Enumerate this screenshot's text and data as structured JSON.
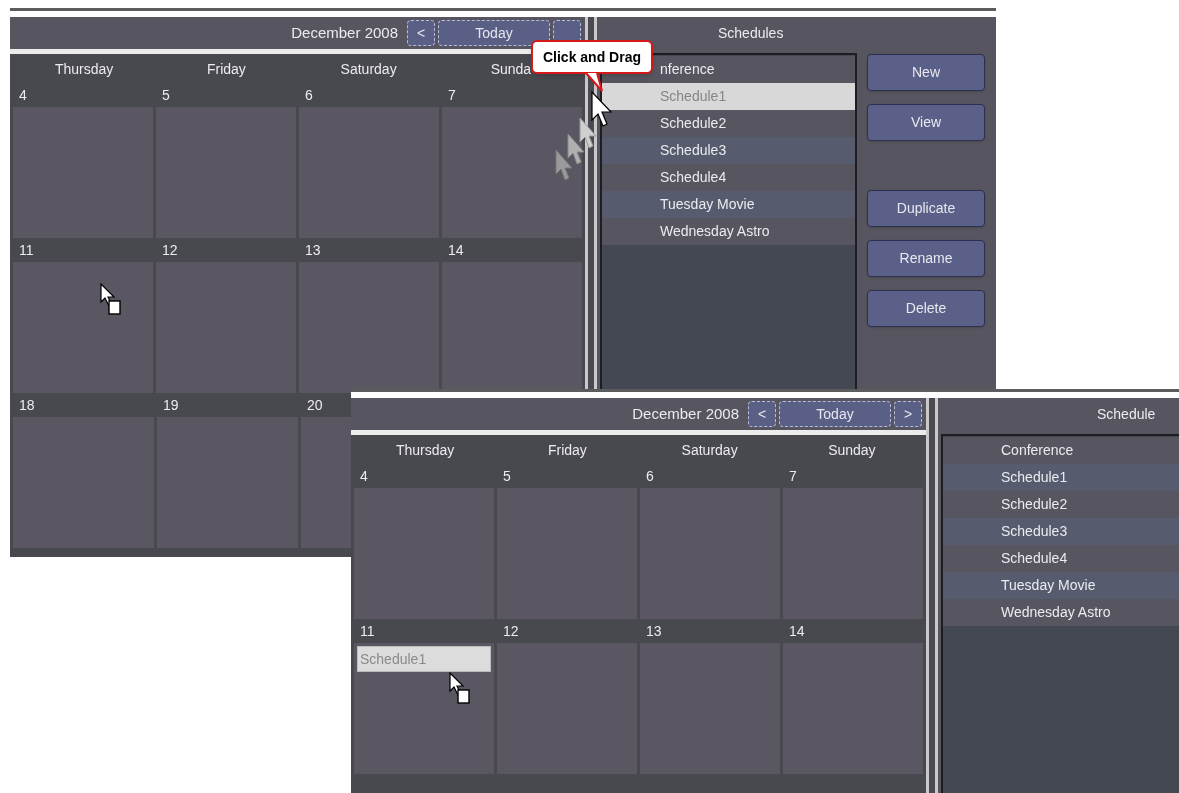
{
  "windows": [
    {
      "header": {
        "month": "December 2008",
        "buttons": [
          {
            "kind": "prev",
            "label": "<"
          },
          {
            "kind": "today",
            "label": "Today"
          },
          {
            "kind": "next"
          }
        ]
      },
      "weekdays": [
        "Thursday",
        "Friday",
        "Saturday",
        "Sunda"
      ],
      "weeks": [
        {
          "days": [
            {
              "date": "4"
            },
            {
              "date": "5"
            },
            {
              "date": "6"
            },
            {
              "date": "7"
            }
          ]
        },
        {
          "days": [
            {
              "date": "11"
            },
            {
              "date": "12"
            },
            {
              "date": "13"
            },
            {
              "date": "14"
            }
          ]
        },
        {
          "days": [
            {
              "date": "18"
            },
            {
              "date": "19"
            },
            {
              "date": "20"
            }
          ]
        }
      ],
      "schedules": {
        "title": "Schedules",
        "items": [
          {
            "label": "nference",
            "selected": false
          },
          {
            "label": "Schedule1",
            "selected": true
          },
          {
            "label": "Schedule2",
            "selected": false
          },
          {
            "label": "Schedule3",
            "selected": false
          },
          {
            "label": "Schedule4",
            "selected": false
          },
          {
            "label": "Tuesday Movie",
            "selected": false
          },
          {
            "label": "Wednesday Astro",
            "selected": false
          }
        ],
        "buttons": [
          {
            "label": "New",
            "kind": "main"
          },
          {
            "label": "View",
            "kind": "main"
          },
          {
            "label": "Duplicate",
            "kind": "edit"
          },
          {
            "label": "Rename",
            "kind": "edit"
          },
          {
            "label": "Delete",
            "kind": "edit"
          }
        ]
      }
    },
    {
      "header": {
        "month": "December 2008",
        "buttons": [
          {
            "kind": "prev",
            "label": "<"
          },
          {
            "kind": "today",
            "label": "Today"
          },
          {
            "kind": "next",
            "label": ">"
          }
        ]
      },
      "weekdays": [
        "Thursday",
        "Friday",
        "Saturday",
        "Sunday"
      ],
      "weeks": [
        {
          "days": [
            {
              "date": "4"
            },
            {
              "date": "5"
            },
            {
              "date": "6"
            },
            {
              "date": "7"
            }
          ]
        },
        {
          "days": [
            {
              "date": "11",
              "event": "Schedule1"
            },
            {
              "date": "12"
            },
            {
              "date": "13"
            },
            {
              "date": "14"
            }
          ]
        }
      ],
      "schedules": {
        "title": "Schedule",
        "items": [
          {
            "label": "Conference",
            "selected": false
          },
          {
            "label": "Schedule1",
            "selected": false
          },
          {
            "label": "Schedule2",
            "selected": false
          },
          {
            "label": "Schedule3",
            "selected": false
          },
          {
            "label": "Schedule4",
            "selected": false
          },
          {
            "label": "Tuesday Movie",
            "selected": false
          },
          {
            "label": "Wednesday Astro",
            "selected": false
          }
        ]
      }
    }
  ],
  "callout": "Click and Drag"
}
